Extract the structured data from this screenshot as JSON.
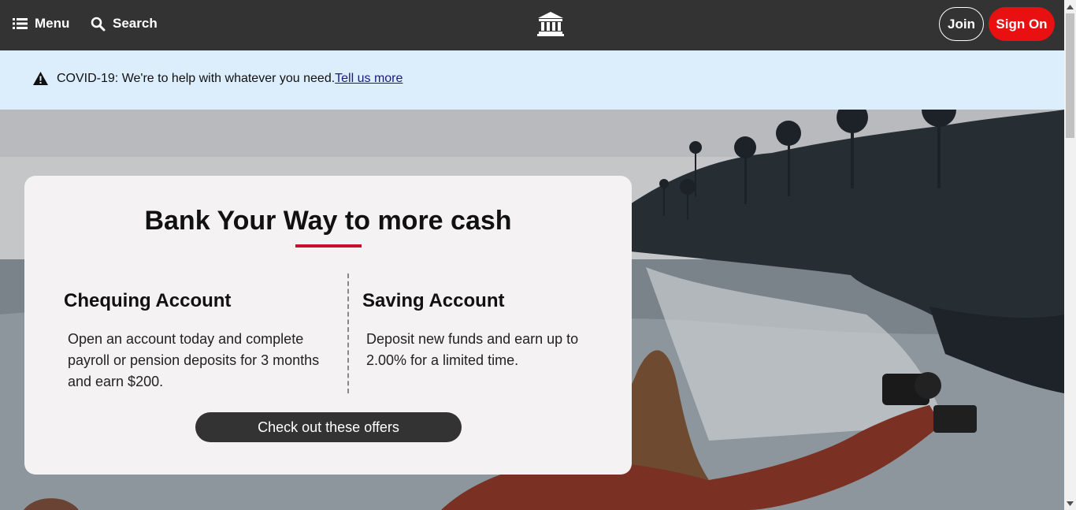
{
  "header": {
    "menu_label": "Menu",
    "search_label": "Search",
    "join_label": "Join",
    "signon_label": "Sign On",
    "logo_icon": "bank-icon"
  },
  "alert": {
    "message": "COVID-19: We're to help with whatever you need.",
    "link_text": "Tell us more",
    "icon": "warning-icon"
  },
  "promo": {
    "title": "Bank Your Way to more cash",
    "chequing": {
      "title": "Chequing Account",
      "body": "Open an account today and complete payroll or pension deposits for 3 months and earn $200."
    },
    "saving": {
      "title": "Saving Account",
      "body": "Deposit new funds and earn up to 2.00% for a limited time."
    },
    "cta_label": "Check out these offers"
  },
  "colors": {
    "header_bg": "#333333",
    "accent_red": "#e81010",
    "rule_red": "#c8102e",
    "alert_bg": "#dcedfc"
  }
}
